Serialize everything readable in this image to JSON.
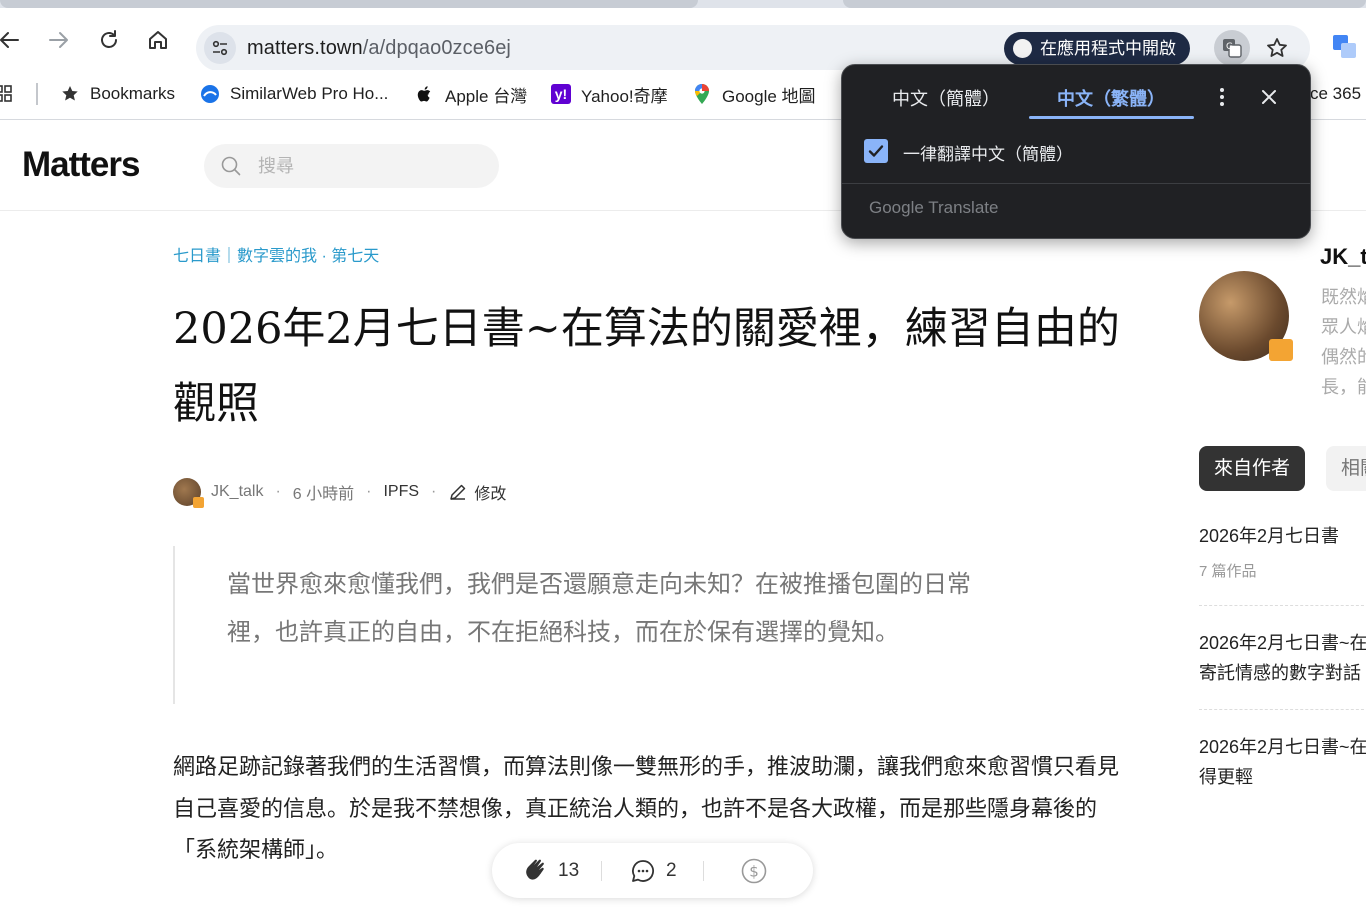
{
  "browser": {
    "url_host": "matters.town",
    "url_path": "/a/dpqao0zce6ej",
    "open_in_app_label": "在應用程式中開啟",
    "bookmarks": [
      {
        "label": "Bookmarks",
        "icon": "star-icon"
      },
      {
        "label": "SimilarWeb Pro Ho...",
        "icon": "similarweb-icon"
      },
      {
        "label": "Apple 台灣",
        "icon": "apple-icon"
      },
      {
        "label": "Yahoo!奇摩",
        "icon": "yahoo-icon"
      },
      {
        "label": "Google 地圖",
        "icon": "maps-pin-icon"
      }
    ],
    "bookmark_overflow": "ce 365"
  },
  "translate_popup": {
    "tab_simplified": "中文（簡體）",
    "tab_traditional": "中文（繁體）",
    "always_translate_label": "一律翻譯中文（簡體）",
    "always_translate_checked": true,
    "brand": "Google Translate"
  },
  "site": {
    "logo": "Matters",
    "search_placeholder": "搜尋"
  },
  "article": {
    "breadcrumb": "七日書｜數字雲的我 · 第七天",
    "title": "2026年2月七日書~在算法的關愛裡，練習自由的觀照",
    "author": "JK_talk",
    "time": "6 小時前",
    "ipfs": "IPFS",
    "edit_label": "修改",
    "quote": "當世界愈來愈懂我們，我們是否還願意走向未知？在被推播包圍的日常裡，也許真正的自由，不在拒絕科技，而在於保有選擇的覺知。",
    "body": "網路足跡記錄著我們的生活習慣，而算法則像一雙無形的手，推波助瀾，讓我們愈來愈習慣只看見自己喜愛的信息。於是我不禁想像，真正統治人類的，也許不是各大政權，而是那些隱身幕後的「系統架構師」。"
  },
  "actions": {
    "claps": "13",
    "comments": "2"
  },
  "sidebar": {
    "author_name": "JK_t",
    "author_bio": "既然焰\n眾人焰\n偶然的\n長，能",
    "tab_from_author": "來自作者",
    "tab_related": "相關",
    "items": [
      {
        "title": "2026年2月七日書",
        "sub": "7 篇作品"
      },
      {
        "title": "2026年2月七日書~在\n寄託情感的數字對話"
      },
      {
        "title": "2026年2月七日書~在\n得更輕"
      }
    ]
  },
  "colors": {
    "accent_link": "#2a9acb",
    "popup_bg": "#202124",
    "popup_accent": "#8ab4f8",
    "badge": "#f3a433"
  }
}
